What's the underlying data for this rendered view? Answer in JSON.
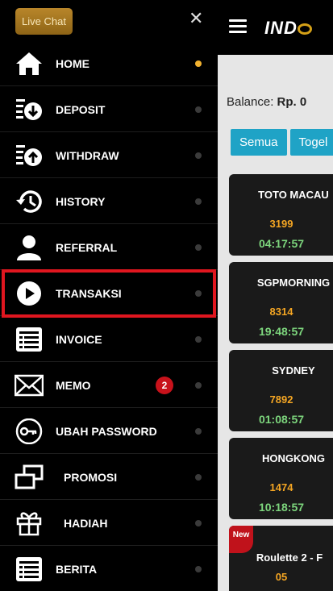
{
  "header": {
    "livechat_label": "Live Chat",
    "close_glyph": "✕",
    "brand_text": "IND"
  },
  "balance": {
    "label": "Balance:",
    "value": "Rp. 0"
  },
  "filters": [
    "Semua",
    "Togel"
  ],
  "results": [
    {
      "market": "TOTO MACAU",
      "number": "3199",
      "time": "04:17:57"
    },
    {
      "market": "SGPMORNING",
      "number": "8314",
      "time": "19:48:57"
    },
    {
      "market": "SYDNEY",
      "number": "7892",
      "time": "01:08:57"
    },
    {
      "market": "HONGKONG",
      "number": "1474",
      "time": "10:18:57"
    },
    {
      "market": "Roulette 2 - F",
      "number": "05",
      "badge": "New"
    }
  ],
  "menu": [
    {
      "label": "HOME",
      "icon": "home-icon",
      "active": true
    },
    {
      "label": "DEPOSIT",
      "icon": "deposit-icon"
    },
    {
      "label": "WITHDRAW",
      "icon": "withdraw-icon"
    },
    {
      "label": "HISTORY",
      "icon": "history-icon"
    },
    {
      "label": "REFERRAL",
      "icon": "user-icon"
    },
    {
      "label": "TRANSAKSI",
      "icon": "play-icon",
      "highlighted": true
    },
    {
      "label": "INVOICE",
      "icon": "invoice-icon"
    },
    {
      "label": "MEMO",
      "icon": "mail-icon",
      "count": "2"
    },
    {
      "label": "UBAH PASSWORD",
      "icon": "key-icon"
    },
    {
      "label": "PROMOSI",
      "icon": "promo-icon"
    },
    {
      "label": "HADIAH",
      "icon": "gift-icon"
    },
    {
      "label": "BERITA",
      "icon": "news-icon"
    }
  ],
  "colors": {
    "accent_gold": "#f2b230",
    "highlight_red": "#e0161f",
    "filter_blue": "#1fa3c6",
    "number_orange": "#f5a623",
    "time_green": "#7dd67d"
  }
}
